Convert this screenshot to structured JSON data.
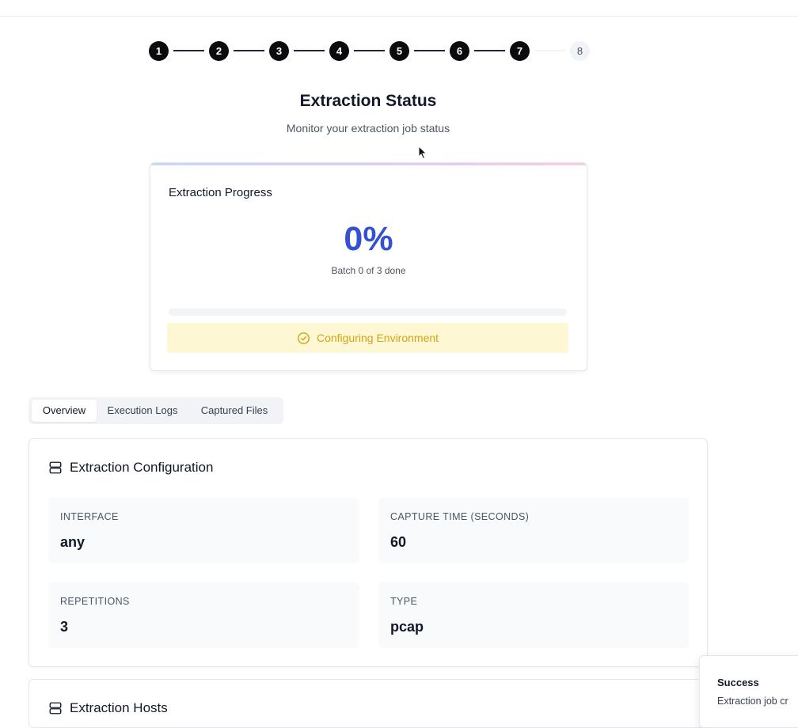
{
  "stepper": {
    "steps": [
      {
        "label": "1",
        "state": "completed"
      },
      {
        "label": "2",
        "state": "completed"
      },
      {
        "label": "3",
        "state": "completed"
      },
      {
        "label": "4",
        "state": "completed"
      },
      {
        "label": "5",
        "state": "completed"
      },
      {
        "label": "6",
        "state": "completed"
      },
      {
        "label": "7",
        "state": "completed"
      },
      {
        "label": "8",
        "state": "pending"
      }
    ]
  },
  "page": {
    "title": "Extraction Status",
    "subtitle": "Monitor your extraction job status"
  },
  "progress": {
    "title": "Extraction Progress",
    "percent_label": "0%",
    "percent_value": 0,
    "batch_text": "Batch 0 of 3 done",
    "status_text": "Configuring Environment",
    "status_icon": "check-circle-icon",
    "accent_colors": [
      "#c7d7fb",
      "#dccdf5",
      "#f6cde0"
    ],
    "percent_color": "#3451d1",
    "status_color": "#d4a414"
  },
  "tabs": [
    {
      "label": "Overview",
      "active": true
    },
    {
      "label": "Execution Logs",
      "active": false
    },
    {
      "label": "Captured Files",
      "active": false
    }
  ],
  "config": {
    "title": "Extraction Configuration",
    "icon": "server-icon",
    "fields": [
      {
        "label": "INTERFACE",
        "value": "any"
      },
      {
        "label": "CAPTURE TIME (SECONDS)",
        "value": "60"
      },
      {
        "label": "REPETITIONS",
        "value": "3"
      },
      {
        "label": "TYPE",
        "value": "pcap"
      }
    ]
  },
  "hosts": {
    "title": "Extraction Hosts",
    "icon": "server-icon"
  },
  "toast": {
    "title": "Success",
    "message": "Extraction job cr"
  }
}
